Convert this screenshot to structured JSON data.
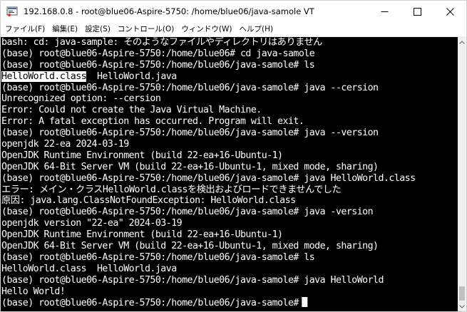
{
  "window": {
    "title": "192.168.0.8 - root@blue06-Aspire-5750: /home/blue06/java-samole VT"
  },
  "menu": {
    "items": [
      "ファイル(F)",
      "編集(E)",
      "設定(S)",
      "コントロール(O)",
      "ウィンドウ(W)",
      "ヘルプ(H)"
    ]
  },
  "terminal": {
    "lines": [
      "bash: cd: java-sample: そのようなファイルやディレクトリはありません",
      "(base) root@blue06-Aspire-5750:/home/blue06# cd java-samole",
      "(base) root@blue06-Aspire-5750:/home/blue06/java-samole# ls",
      "",
      "(base) root@blue06-Aspire-5750:/home/blue06/java-samole# java --cersion",
      "Unrecognized option: --cersion",
      "Error: Could not create the Java Virtual Machine.",
      "Error: A fatal exception has occurred. Program will exit.",
      "(base) root@blue06-Aspire-5750:/home/blue06/java-samole# java --version",
      "openjdk 22-ea 2024-03-19",
      "OpenJDK Runtime Environment (build 22-ea+16-Ubuntu-1)",
      "OpenJDK 64-Bit Server VM (build 22-ea+16-Ubuntu-1, mixed mode, sharing)",
      "(base) root@blue06-Aspire-5750:/home/blue06/java-samole# java HelloWorld.class",
      "エラー: メイン・クラスHelloWorld.classを検出およびロードできませんでした",
      "原因: java.lang.ClassNotFoundException: HelloWorld.class",
      "(base) root@blue06-Aspire-5750:/home/blue06/java-samole# java -version",
      "openjdk version \"22-ea\" 2024-03-19",
      "OpenJDK Runtime Environment (build 22-ea+16-Ubuntu-1)",
      "OpenJDK 64-Bit Server VM (build 22-ea+16-Ubuntu-1, mixed mode, sharing)",
      "(base) root@blue06-Aspire-5750:/home/blue06/java-samole# ls",
      "HelloWorld.class  HelloWorld.java",
      "(base) root@blue06-Aspire-5750:/home/blue06/java-samole# java HelloWorld",
      "Hello World!",
      "(base) root@blue06-Aspire-5750:/home/blue06/java-samole#"
    ],
    "ls_output_selected": "HelloWorld.class",
    "ls_output_rest": "  HelloWorld.java"
  },
  "colors": {
    "terminal_bg": "#000000",
    "terminal_fg": "#ffffff",
    "titlebar_bg": "#ffffff",
    "scrollbar_bg": "#f0f0f0"
  },
  "icons": {
    "app": "teraterm-icon",
    "minimize": "minimize-icon",
    "maximize": "maximize-icon",
    "close": "close-icon"
  }
}
